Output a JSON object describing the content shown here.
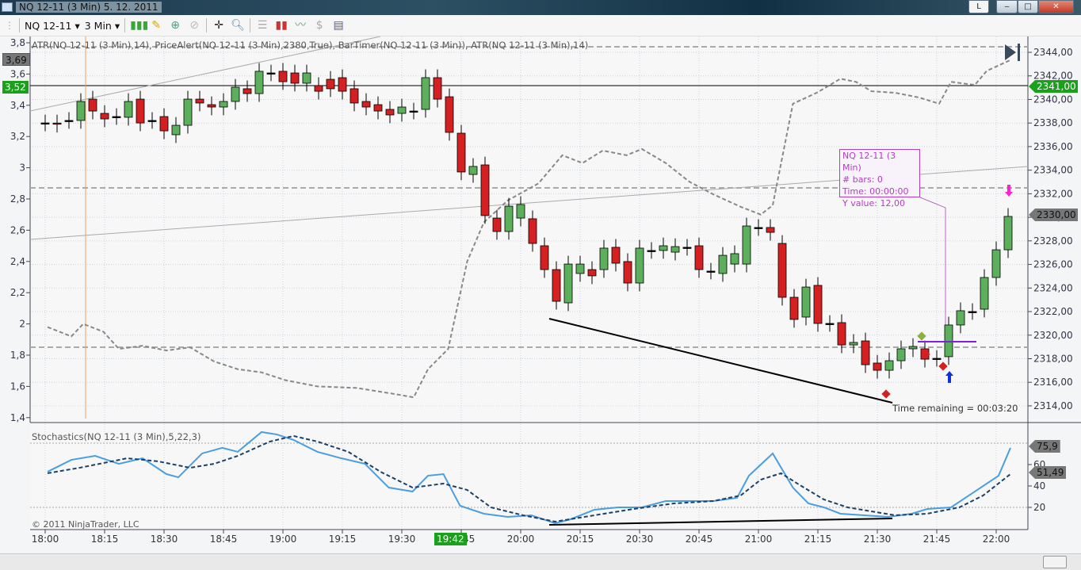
{
  "window": {
    "title": "NQ 12-11 (3 Min)  5. 12. 2011",
    "btn_l": "L",
    "btn_min": "‒",
    "btn_max": "□",
    "btn_close": "✕"
  },
  "toolbar": {
    "instrument": "NQ 12-11",
    "interval": "3 Min",
    "icons": [
      "bar-type-icon",
      "drawing-pencil-icon",
      "add-indicator-icon",
      "remove-indicator-icon",
      "crosshair-icon",
      "zoom-icon",
      "data-box-icon",
      "chart-style-icon",
      "chart-trader-icon",
      "dollar-icon",
      "properties-icon"
    ]
  },
  "chart": {
    "indicators_label": "ATR(NQ 12-11 (3 Min),14), PriceAlert(NQ 12-11 (3 Min),2380,True), BarTimer(NQ 12-11 (3 Min)), ATR(NQ 12-11 (3 Min),14)",
    "left_axis": [
      "3,8",
      "3,6",
      "3,4",
      "3,2",
      "3",
      "2,8",
      "2,6",
      "2,4",
      "2,2",
      "2",
      "1,8",
      "1,6",
      "1,4"
    ],
    "right_axis": [
      "2344,00",
      "2342,00",
      "2340,00",
      "2338,00",
      "2336,00",
      "2334,00",
      "2332,00",
      "2330,00",
      "2328,00",
      "2326,00",
      "2324,00",
      "2322,00",
      "2320,00",
      "2318,00",
      "2316,00",
      "2314,00"
    ],
    "atr_current": "3,69",
    "atr_current2": "3,52",
    "price_alert": "2341,00",
    "last_price": "2330,00",
    "time_remaining": "Time remaining = 00:03:20",
    "tooltip": {
      "line1": "NQ 12-11 (3 Min)",
      "line2": "# bars:  0",
      "line3": "Time:     00:00:00",
      "line4": "Y value: 12,00"
    },
    "colors": {
      "up": "#5cb05c",
      "down": "#d42020",
      "alert": "#1aa01a",
      "atr": "#888888",
      "stoch_k": "#4a9ee0",
      "stoch_d": "#1e3f66"
    }
  },
  "stoch": {
    "label": "Stochastics(NQ 12-11 (3 Min),5,22,3)",
    "axis": [
      "60",
      "40",
      "20"
    ],
    "k_value": "75,9",
    "d_value": "51,49",
    "copyright": "© 2011 NinjaTrader, LLC"
  },
  "time_axis": {
    "labels": [
      "18:00",
      "18:15",
      "18:30",
      "18:45",
      "19:00",
      "19:15",
      "19:30",
      "19:45",
      "20:00",
      "20:15",
      "20:30",
      "20:45",
      "21:00",
      "21:15",
      "21:30",
      "21:45",
      "22:00"
    ],
    "highlight": "19:42"
  },
  "chart_data": {
    "type": "candlestick",
    "bar_minutes": 3,
    "start": "18:00",
    "ohlc_oc": [
      [
        2338.01,
        2338.01
      ],
      [
        2338.0,
        2337.9
      ],
      [
        2338.22,
        2338.22
      ],
      [
        2338.22,
        2339.83
      ],
      [
        2340.03,
        2339.02
      ],
      [
        2338.82,
        2338.35
      ],
      [
        2338.55,
        2338.55
      ],
      [
        2338.49,
        2339.83
      ],
      [
        2340.03,
        2338.01
      ],
      [
        2338.22,
        2338.22
      ],
      [
        2338.55,
        2337.34
      ],
      [
        2337.01,
        2337.81
      ],
      [
        2337.81,
        2340.03
      ],
      [
        2340.03,
        2339.7
      ],
      [
        2339.56,
        2339.36
      ],
      [
        2339.36,
        2339.83
      ],
      [
        2339.83,
        2341.04
      ],
      [
        2340.91,
        2340.5
      ],
      [
        2340.5,
        2342.39
      ],
      [
        2342.25,
        2342.25
      ],
      [
        2342.39,
        2341.51
      ],
      [
        2342.25,
        2341.38
      ],
      [
        2341.38,
        2342.25
      ],
      [
        2341.18,
        2340.7
      ],
      [
        2341.71,
        2340.91
      ],
      [
        2341.85,
        2340.7
      ],
      [
        2340.91,
        2339.7
      ],
      [
        2339.83,
        2339.36
      ],
      [
        2339.56,
        2339.02
      ],
      [
        2339.16,
        2338.69
      ],
      [
        2338.82,
        2339.36
      ],
      [
        2339.02,
        2339.02
      ],
      [
        2339.16,
        2341.85
      ],
      [
        2341.85,
        2340.03
      ],
      [
        2340.23,
        2337.21
      ],
      [
        2337.14,
        2333.85
      ],
      [
        2333.64,
        2334.32
      ],
      [
        2334.45,
        2330.15
      ],
      [
        2329.94,
        2328.8
      ],
      [
        2328.8,
        2330.95
      ],
      [
        2329.94,
        2331.09
      ],
      [
        2329.88,
        2327.79
      ],
      [
        2327.59,
        2325.57
      ],
      [
        2325.57,
        2322.88
      ],
      [
        2322.75,
        2326.04
      ],
      [
        2325.24,
        2326.04
      ],
      [
        2325.57,
        2325.04
      ],
      [
        2325.57,
        2327.39
      ],
      [
        2327.46,
        2326.11
      ],
      [
        2326.25,
        2324.43
      ],
      [
        2324.43,
        2327.39
      ],
      [
        2327.19,
        2327.19
      ],
      [
        2327.19,
        2327.59
      ],
      [
        2327.05,
        2327.52
      ],
      [
        2327.46,
        2327.46
      ],
      [
        2327.59,
        2325.57
      ],
      [
        2325.44,
        2325.44
      ],
      [
        2325.24,
        2326.78
      ],
      [
        2326.04,
        2326.92
      ],
      [
        2326.04,
        2329.27
      ],
      [
        2329.14,
        2329.14
      ],
      [
        2329.14,
        2328.73
      ],
      [
        2327.79,
        2323.22
      ],
      [
        2323.22,
        2321.34
      ],
      [
        2321.54,
        2324.09
      ],
      [
        2324.23,
        2321.0
      ],
      [
        2321.0,
        2321.0
      ],
      [
        2321.07,
        2319.18
      ],
      [
        2319.18,
        2319.39
      ],
      [
        2319.52,
        2317.5
      ],
      [
        2317.64,
        2317.03
      ],
      [
        2317.03,
        2317.84
      ],
      [
        2317.84,
        2318.85
      ],
      [
        2318.85,
        2319.05
      ],
      [
        2318.85,
        2317.97
      ],
      [
        2318.04,
        2318.04
      ],
      [
        2318.18,
        2320.87
      ],
      [
        2320.87,
        2322.08
      ],
      [
        2322.01,
        2322.01
      ],
      [
        2322.21,
        2324.9
      ],
      [
        2324.9,
        2327.25
      ],
      [
        2327.25,
        2330.08
      ]
    ],
    "atr": [
      [
        0.2,
        1.98
      ],
      [
        2.2,
        1.92
      ],
      [
        3.2,
        2.0
      ],
      [
        4.9,
        1.95
      ],
      [
        6.2,
        1.84
      ],
      [
        8.2,
        1.86
      ],
      [
        10.2,
        1.83
      ],
      [
        12.2,
        1.85
      ],
      [
        14.2,
        1.76
      ],
      [
        16.2,
        1.71
      ],
      [
        18.2,
        1.69
      ],
      [
        20.2,
        1.64
      ],
      [
        22.9,
        1.6
      ],
      [
        26.2,
        1.59
      ],
      [
        29.5,
        1.55
      ],
      [
        31,
        1.53
      ],
      [
        32.2,
        1.71
      ],
      [
        33.9,
        1.84
      ],
      [
        35.5,
        2.4
      ],
      [
        36.9,
        2.65
      ],
      [
        38.9,
        2.79
      ],
      [
        41.5,
        2.9
      ],
      [
        43.5,
        3.08
      ],
      [
        45.2,
        3.03
      ],
      [
        46.9,
        3.11
      ],
      [
        48.9,
        3.08
      ],
      [
        50.2,
        3.12
      ],
      [
        52.2,
        3.03
      ],
      [
        54.2,
        2.91
      ],
      [
        56.2,
        2.83
      ],
      [
        58.5,
        2.75
      ],
      [
        60.2,
        2.7
      ],
      [
        61.2,
        2.76
      ],
      [
        62.9,
        3.41
      ],
      [
        64.9,
        3.48
      ],
      [
        66.9,
        3.57
      ],
      [
        68.2,
        3.55
      ],
      [
        69.5,
        3.49
      ],
      [
        71.5,
        3.48
      ],
      [
        73.5,
        3.45
      ],
      [
        75.2,
        3.41
      ],
      [
        76.2,
        3.55
      ],
      [
        78.2,
        3.53
      ],
      [
        79.2,
        3.62
      ],
      [
        81.2,
        3.69
      ]
    ],
    "stoch_k": [
      [
        0.2,
        53.3
      ],
      [
        2.2,
        64.4
      ],
      [
        4.2,
        68.1
      ],
      [
        6.2,
        60.7
      ],
      [
        8.2,
        65.9
      ],
      [
        10.2,
        51.1
      ],
      [
        11.2,
        48.1
      ],
      [
        13.2,
        70.4
      ],
      [
        14.9,
        75.6
      ],
      [
        16.2,
        71.9
      ],
      [
        18.2,
        90.4
      ],
      [
        19.5,
        88.1
      ],
      [
        20.9,
        83.0
      ],
      [
        22.9,
        71.9
      ],
      [
        24.9,
        65.9
      ],
      [
        26.9,
        60.7
      ],
      [
        28.9,
        38.5
      ],
      [
        30.9,
        34.8
      ],
      [
        32.2,
        49.6
      ],
      [
        33.5,
        51.1
      ],
      [
        34.9,
        21.5
      ],
      [
        36.9,
        14.1
      ],
      [
        38.9,
        11.1
      ],
      [
        40.9,
        12.6
      ],
      [
        42.9,
        5.2
      ],
      [
        44.2,
        8.9
      ],
      [
        46.2,
        17.8
      ],
      [
        48.2,
        20
      ],
      [
        50.2,
        20
      ],
      [
        52.2,
        25.9
      ],
      [
        54.2,
        25.9
      ],
      [
        56.2,
        25.9
      ],
      [
        58.2,
        28.9
      ],
      [
        59.2,
        49.6
      ],
      [
        61.2,
        70.4
      ],
      [
        62.9,
        38.5
      ],
      [
        64.2,
        23.7
      ],
      [
        65.5,
        20
      ],
      [
        66.9,
        14.1
      ],
      [
        68.9,
        12.6
      ],
      [
        70.9,
        11.1
      ],
      [
        72.9,
        14.1
      ],
      [
        74.2,
        18.5
      ],
      [
        76.2,
        20
      ],
      [
        78.2,
        34.8
      ],
      [
        80.2,
        49.6
      ],
      [
        81.2,
        75.6
      ]
    ],
    "stoch_d": [
      [
        0.2,
        51.9
      ],
      [
        2.9,
        57.0
      ],
      [
        6.9,
        65.9
      ],
      [
        9.5,
        63.0
      ],
      [
        12.2,
        57.0
      ],
      [
        14.2,
        60.7
      ],
      [
        16.2,
        68.1
      ],
      [
        18.9,
        81.5
      ],
      [
        20.9,
        86.7
      ],
      [
        22.9,
        81.5
      ],
      [
        25.5,
        71.9
      ],
      [
        28.2,
        53.3
      ],
      [
        30.9,
        38.5
      ],
      [
        33.5,
        42.2
      ],
      [
        35.5,
        36.3
      ],
      [
        37.5,
        20
      ],
      [
        40.2,
        12.6
      ],
      [
        42.9,
        6.7
      ],
      [
        46.2,
        12.6
      ],
      [
        49.5,
        18.5
      ],
      [
        52.9,
        23.7
      ],
      [
        56.2,
        25.9
      ],
      [
        58.5,
        31.1
      ],
      [
        60.2,
        45.9
      ],
      [
        61.9,
        51.9
      ],
      [
        63.5,
        40.7
      ],
      [
        65.5,
        27.4
      ],
      [
        67.5,
        20
      ],
      [
        69.5,
        16.3
      ],
      [
        71.5,
        12.6
      ],
      [
        74.2,
        14.1
      ],
      [
        76.9,
        20
      ],
      [
        78.9,
        31.1
      ],
      [
        81.2,
        51.1
      ]
    ]
  }
}
